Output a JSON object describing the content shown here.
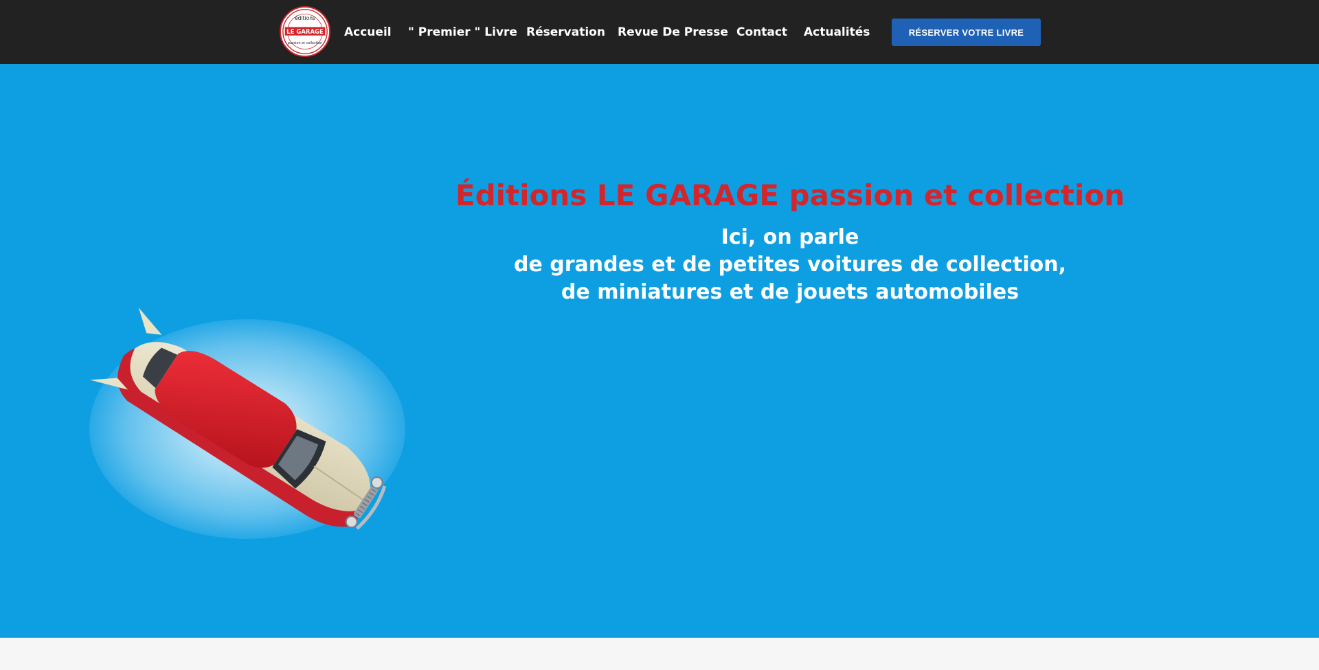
{
  "header": {
    "logo": {
      "top_text": "éditions",
      "main_text": "LE GARAGE",
      "bottom_text": "passion et collection"
    },
    "nav": [
      {
        "label": "Accueil"
      },
      {
        "label": "\" Premier \" Livre"
      },
      {
        "label": "Réservation"
      },
      {
        "label": "Revue De Presse"
      },
      {
        "label": "Contact"
      },
      {
        "label": "Actualités"
      }
    ],
    "cta_label": "RÉSERVER VOTRE LIVRE"
  },
  "hero": {
    "title": "Éditions LE GARAGE passion et collection",
    "subtitle_lines": [
      "Ici, on parle",
      "de grandes et de petites voitures de collection,",
      "de miniatures et de jouets automobiles"
    ],
    "image": "toy-car-image"
  },
  "colors": {
    "navbar": "#222222",
    "hero_background": "#0e9fe3",
    "title": "#d3262c",
    "cta": "#1f61b5"
  }
}
